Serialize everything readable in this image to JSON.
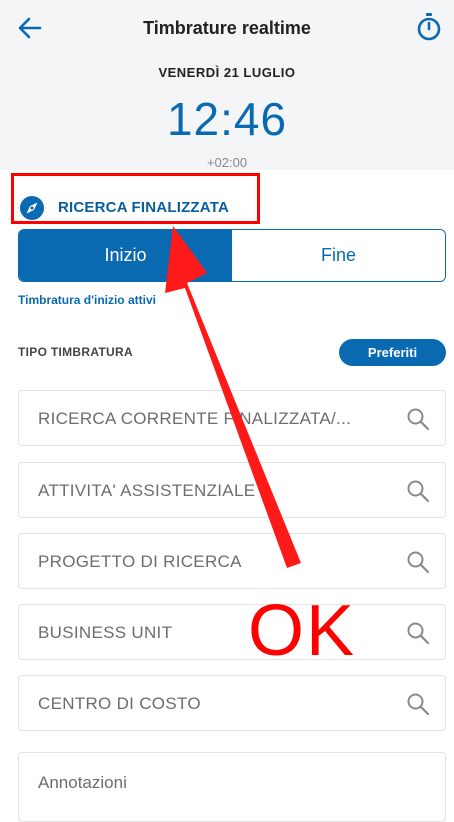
{
  "header": {
    "title": "Timbrature realtime",
    "date": "VENERDÌ 21 LUGLIO",
    "time": "12:46",
    "timezone": "+02:00"
  },
  "section": {
    "label": "RICERCA FINALIZZATA"
  },
  "segment": {
    "start_label": "Inizio",
    "end_label": "Fine",
    "selected": "Inizio"
  },
  "status_text": "Timbratura d'inizio attivi",
  "tipo": {
    "label": "TIPO TIMBRATURA",
    "favorites_label": "Preferiti"
  },
  "fields": [
    {
      "placeholder": "RICERCA CORRENTE FINALIZZATA/..."
    },
    {
      "placeholder": "ATTIVITA' ASSISTENZIALE"
    },
    {
      "placeholder": "PROGETTO DI RICERCA"
    },
    {
      "placeholder": "BUSINESS UNIT"
    },
    {
      "placeholder": "CENTRO DI COSTO"
    }
  ],
  "notes": {
    "placeholder": "Annotazioni"
  },
  "annotation": {
    "ok_text": "OK",
    "color": "#ff0000"
  },
  "colors": {
    "accent": "#0a6ab1",
    "header_bg": "#f3f5f7"
  }
}
